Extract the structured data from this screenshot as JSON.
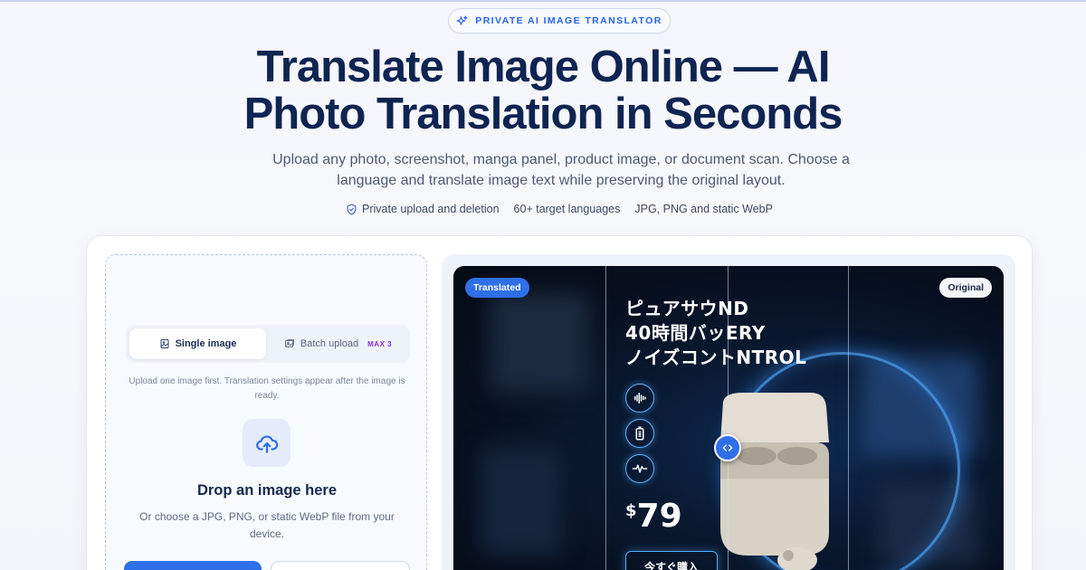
{
  "badge": {
    "label": "PRIVATE AI IMAGE TRANSLATOR",
    "icon": "sparkles-icon"
  },
  "hero": {
    "title_line1": "Translate Image Online — AI",
    "title_line2": "Photo Translation in Seconds",
    "subtitle": "Upload any photo, screenshot, manga panel, product image, or document scan. Choose a language and translate image text while preserving the original layout."
  },
  "features": [
    {
      "label": "Private upload and deletion",
      "icon": "shield-check-icon"
    },
    {
      "label": "60+ target languages"
    },
    {
      "label": "JPG, PNG and static WebP"
    }
  ],
  "uploader": {
    "tabs": [
      {
        "label": "Single image",
        "icon": "image-file-icon",
        "active": true
      },
      {
        "label": "Batch upload",
        "icon": "images-icon",
        "badge": "MAX 3",
        "active": false
      }
    ],
    "hint": "Upload one image first. Translation settings appear after the image is ready.",
    "upload_icon": "cloud-upload-icon",
    "drop_title": "Drop an image here",
    "drop_subtitle": "Or choose a JPG, PNG, or static WebP file from your device."
  },
  "preview": {
    "translated_tag": "Translated",
    "original_tag": "Original",
    "headline": [
      "ピュアサウND",
      "40時間バッERY",
      "ノイズコントNTROL"
    ],
    "price_currency": "$",
    "price_amount": "79",
    "buy_label": "今すぐ購入",
    "handle_icon": "code-arrows-icon",
    "comparison_position": 0.5
  },
  "colors": {
    "accent": "#2f6fe8",
    "title": "#0e2452",
    "batch_badge": "#8b33d6"
  }
}
